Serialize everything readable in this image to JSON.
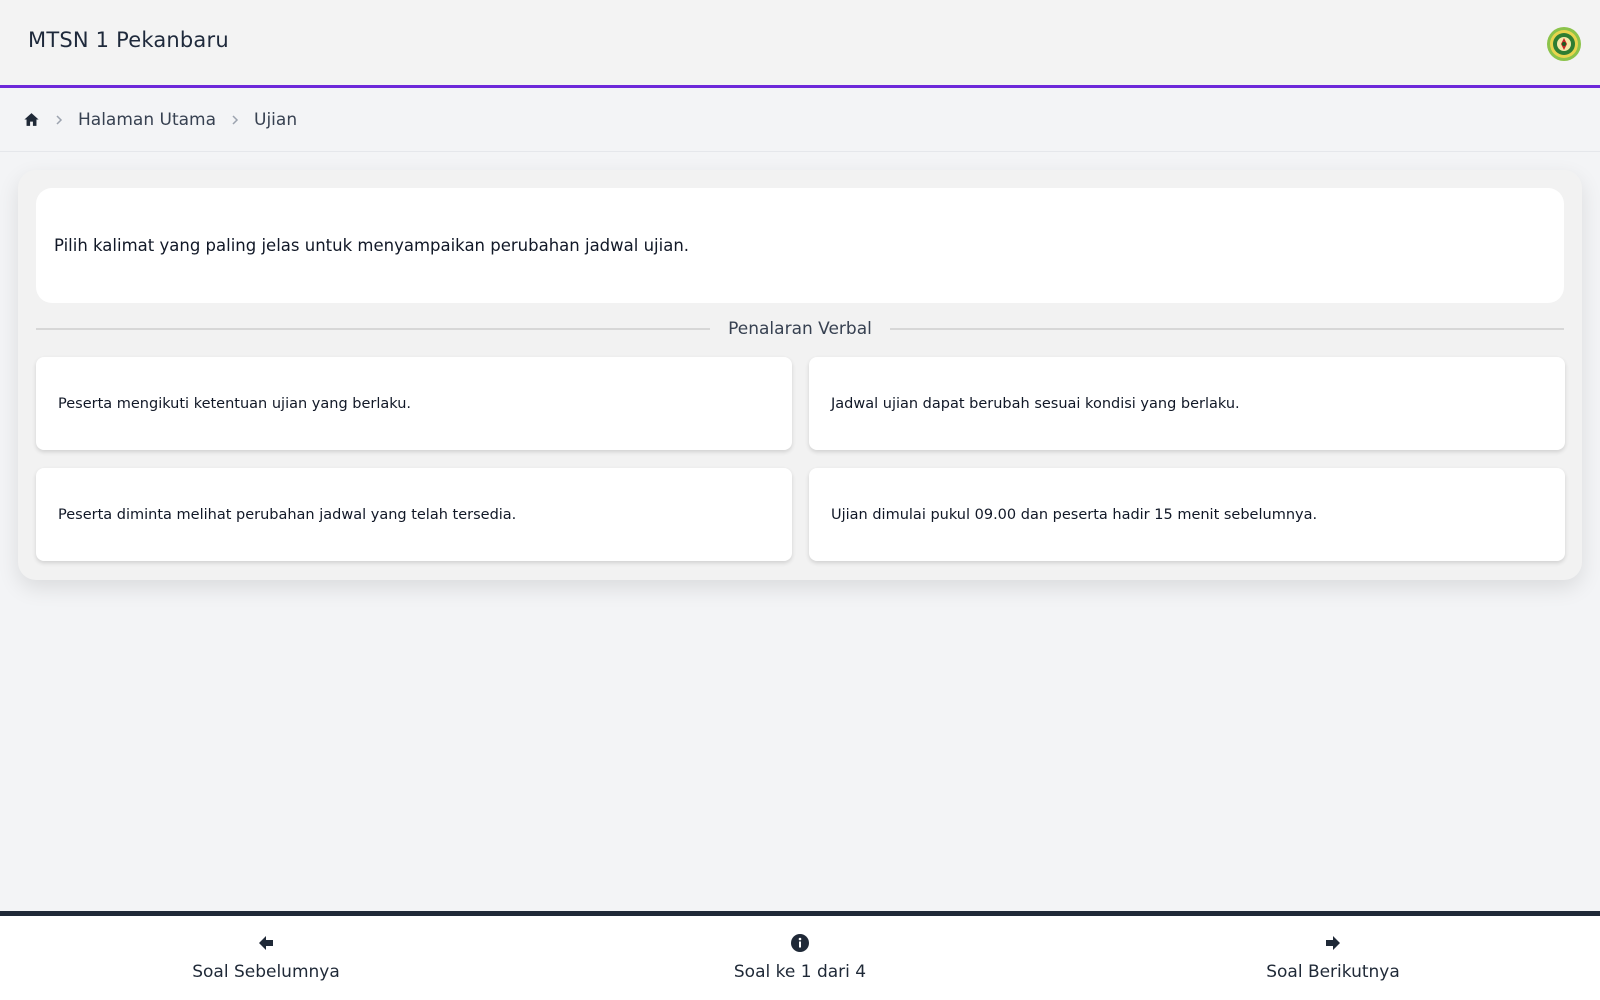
{
  "header": {
    "title": "MTSN 1 Pekanbaru",
    "logo_icon": "school-emblem-icon",
    "accent_color": "#6d28d9"
  },
  "breadcrumb": {
    "home_icon": "home-icon",
    "items": [
      "Halaman Utama",
      "Ujian"
    ]
  },
  "question": {
    "text": "Pilih kalimat yang paling jelas untuk menyampaikan perubahan jadwal ujian.",
    "category": "Penalaran Verbal",
    "options": [
      "Peserta mengikuti ketentuan ujian yang berlaku.",
      "Jadwal ujian dapat berubah sesuai kondisi yang berlaku.",
      "Peserta diminta melihat perubahan jadwal yang telah tersedia.",
      "Ujian dimulai pukul 09.00 dan peserta hadir 15 menit sebelumnya."
    ]
  },
  "footer_nav": {
    "prev_label": "Soal Sebelumnya",
    "info_label": "Soal ke 1 dari 4",
    "next_label": "Soal Berikutnya",
    "prev_icon": "arrow-left-icon",
    "info_icon": "info-icon",
    "next_icon": "arrow-right-icon"
  }
}
